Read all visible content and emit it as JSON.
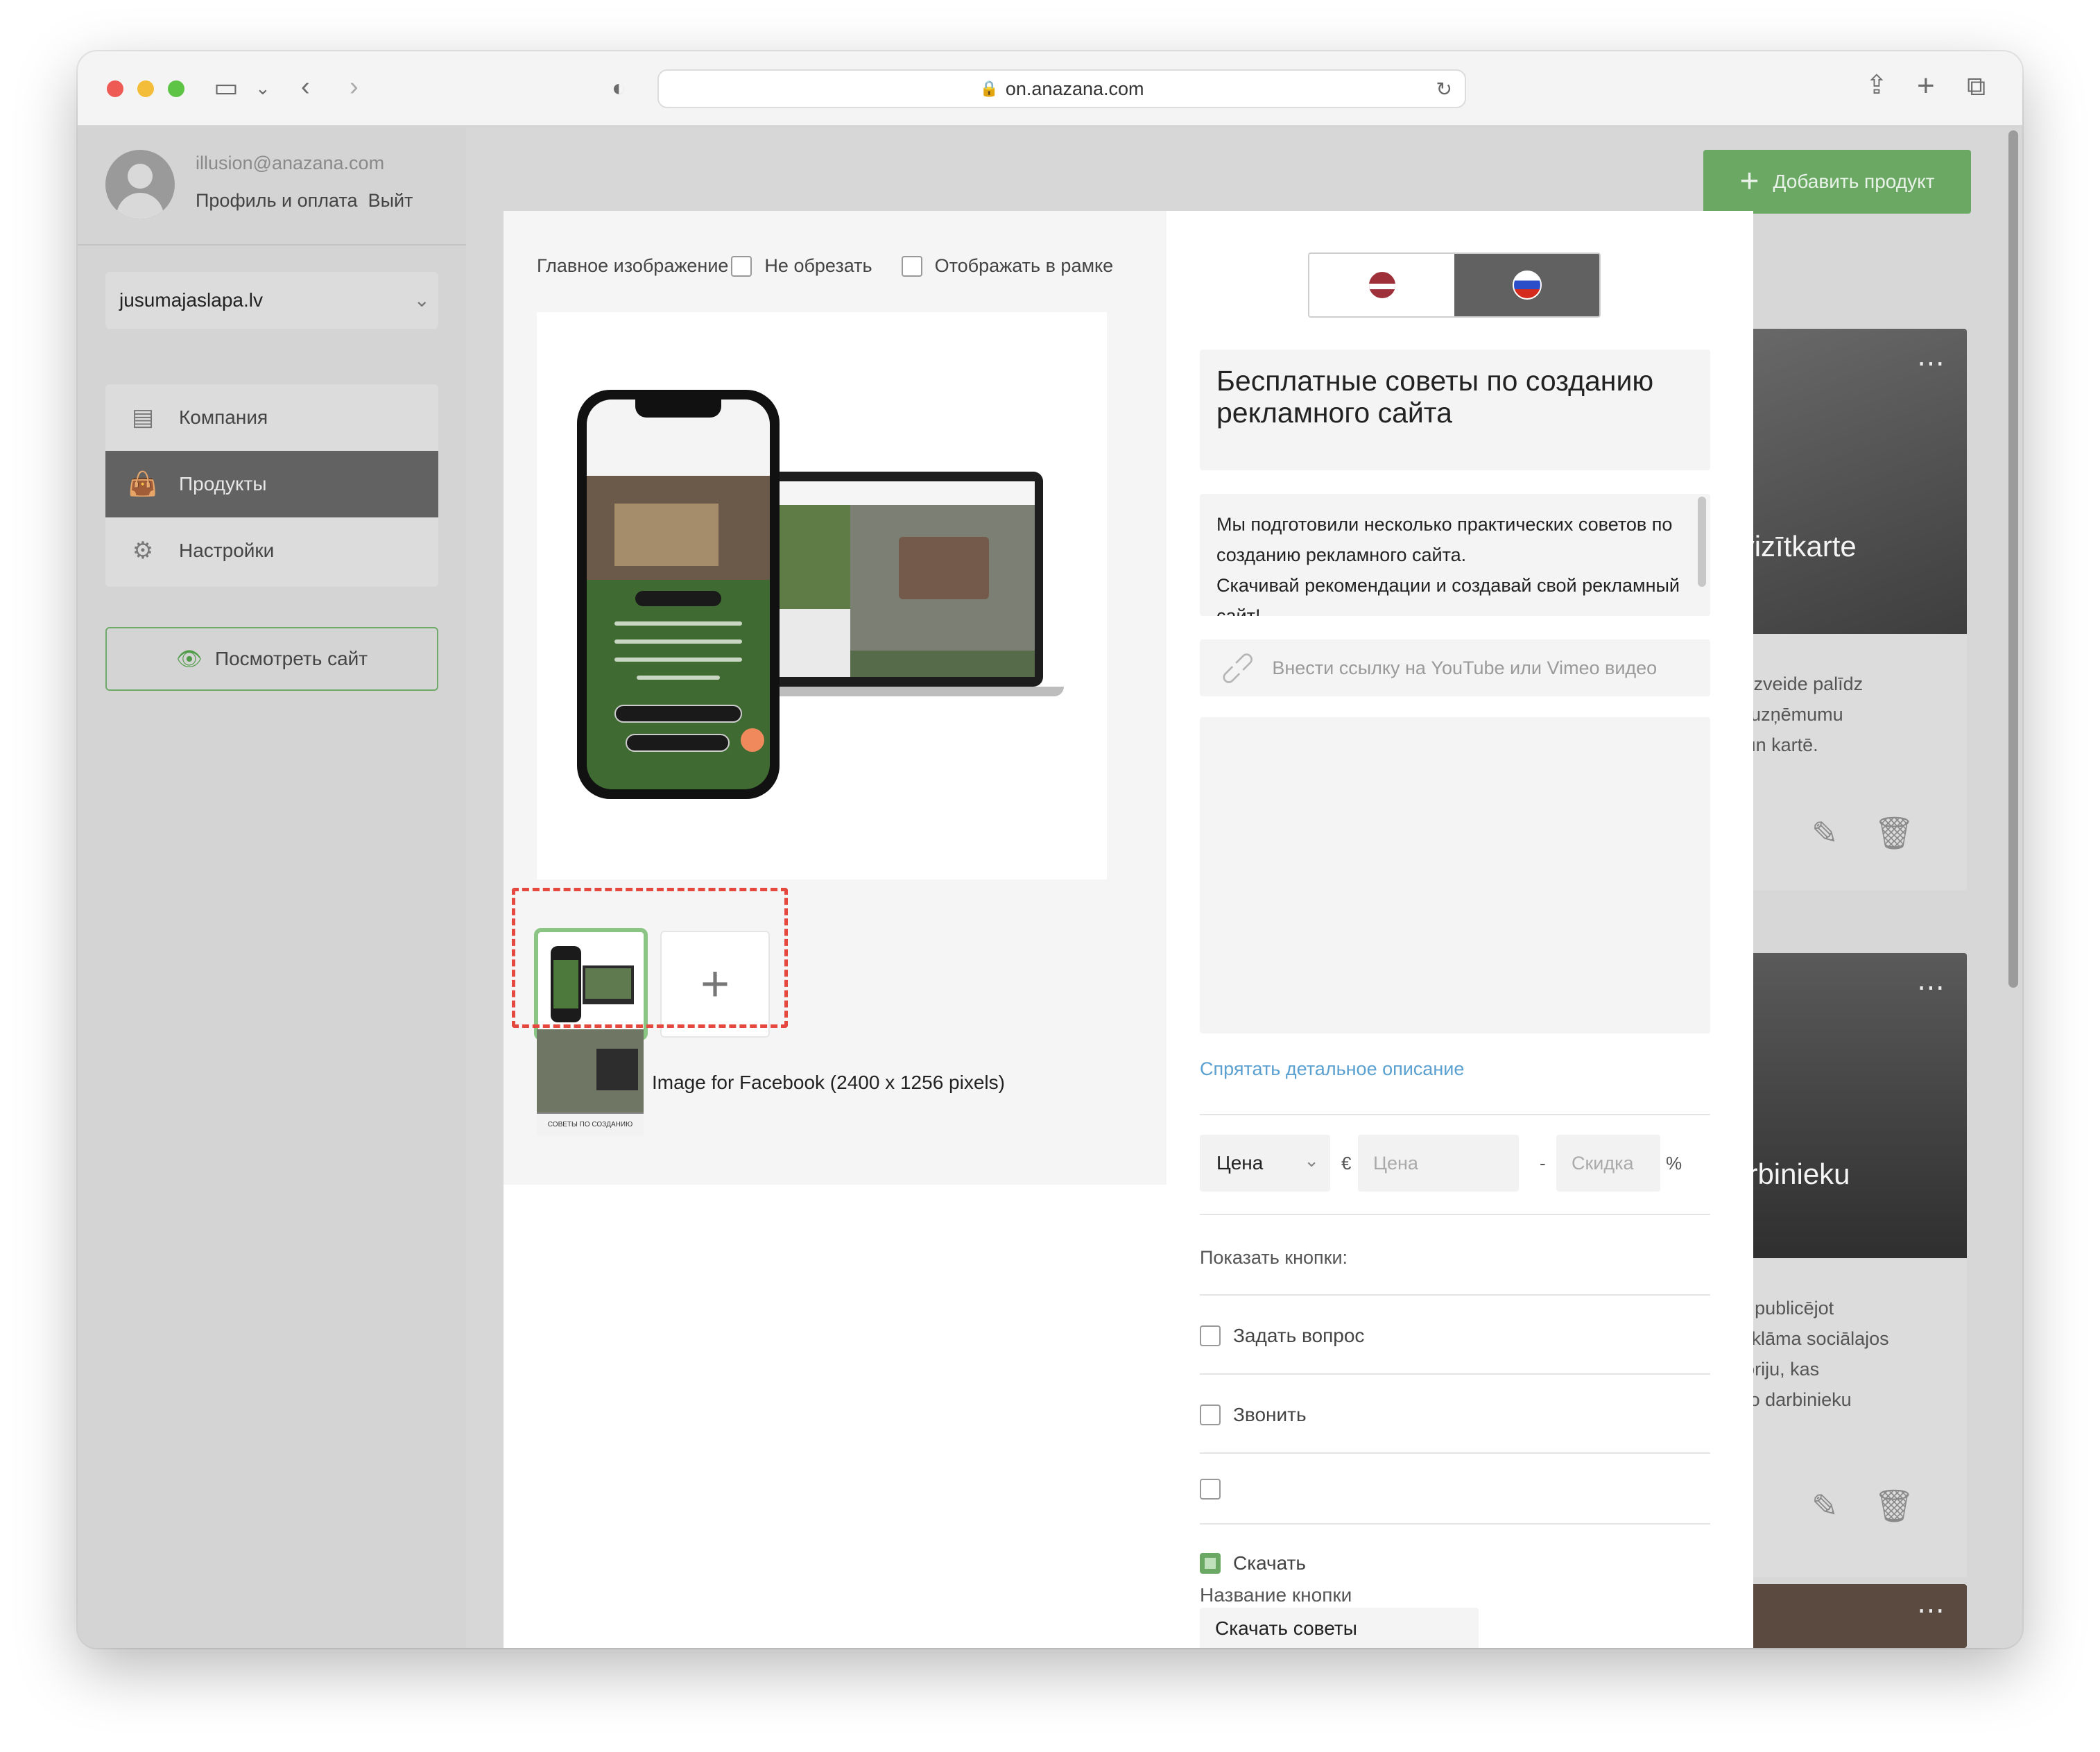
{
  "browser": {
    "url": "on.anazana.com"
  },
  "sidebar": {
    "user_email": "illusion@anazana.com",
    "profile_link": "Профиль и оплата",
    "logout_link": "Выйт",
    "site_selector": "jusumajaslapa.lv",
    "nav": [
      {
        "label": "Компания",
        "icon": "chat-icon"
      },
      {
        "label": "Продукты",
        "icon": "shopping-bag-icon",
        "active": true
      },
      {
        "label": "Настройки",
        "icon": "gear-icon"
      }
    ],
    "view_site_label": "Посмотреть сайт"
  },
  "header": {
    "add_product_label": "Добавить продукт"
  },
  "cards": [
    {
      "title": "numa vizītkarte",
      "desc": "ess profila izveide palīdz\nmanīt jūsu uzņēmumu\n rezultātos un kartē."
    },
    {
      "title": "apa darbinieku\nai",
      "desc": "arbiniekus, publicējot\ns tīklos! Reklāma sociālajos\nšāku auditoriju, kas\nu potenciālo darbinieku\n."
    }
  ],
  "modal": {
    "main_image_label": "Главное изображение",
    "no_crop_label": "Не обрезать",
    "frame_label": "Отображать в рамке",
    "facebook_image_label": "Image for Facebook (2400 x 1256 pixels)",
    "fb_thumb_caption": "СОВЕТЫ ПО СОЗДАНИЮ",
    "languages": [
      {
        "code": "lv",
        "active": false
      },
      {
        "code": "ru",
        "active": true
      }
    ],
    "title": "Бесплатные советы по созданию рекламного сайта",
    "description": "Мы подготовили несколько практических советов по созданию рекламного сайта.\nСкачивай рекомендации и создавай свой рекламный сайт!",
    "video_placeholder": "Внести ссылку на YouTube или Vimeo видео",
    "hide_details_link": "Спрятать детальное описание",
    "price_type": "Цена",
    "currency": "€",
    "price_placeholder": "Цена",
    "discount_placeholder": "Скидка",
    "percent": "%",
    "show_buttons_label": "Показать кнопки:",
    "buttons": [
      {
        "label": "Задать вопрос",
        "checked": false
      },
      {
        "label": "Звонить",
        "checked": false
      },
      {
        "label": "",
        "checked": false
      },
      {
        "label": "Скачать",
        "checked": true
      }
    ],
    "button_name_label": "Название кнопки",
    "button_name_value": "Скачать советы"
  },
  "colors": {
    "accent_green": "#6aa864",
    "highlight_red": "#e5483f",
    "link_blue": "#5aa0d0"
  }
}
